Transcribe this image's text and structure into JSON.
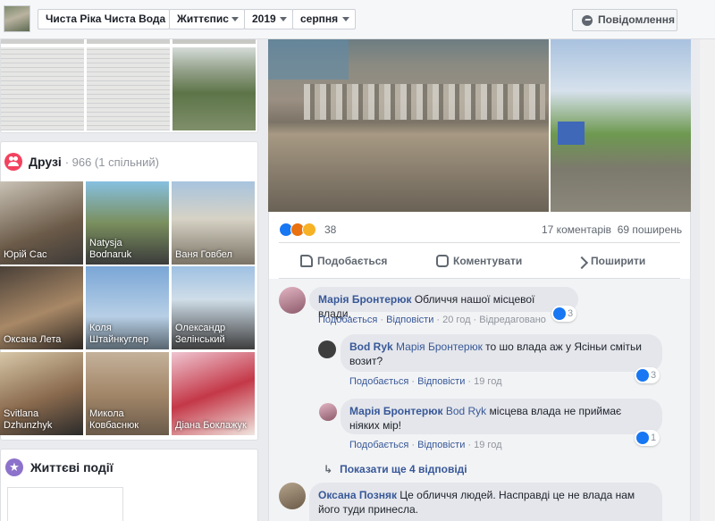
{
  "topbar": {
    "page_name": "Чиста Ріка Чиста Вода",
    "section": "Життєпис",
    "year": "2019",
    "month": "серпня",
    "message_button": "Повідомлення"
  },
  "friends": {
    "title": "Друзі",
    "count": "· 966 (1 спільний)",
    "items": [
      {
        "name": "Юрій Сас"
      },
      {
        "name": "Natysja Bodnaruk"
      },
      {
        "name": "Ваня Говбел"
      },
      {
        "name": "Оксана Лета"
      },
      {
        "name": "Коля Штайнкуглер"
      },
      {
        "name": "Олександр Зелінський"
      },
      {
        "name": "Svitlana Dzhunzhyk"
      },
      {
        "name": "Микола Ковбаснюк"
      },
      {
        "name": "Діана Боклажук"
      }
    ]
  },
  "life_events": {
    "title": "Життєві події"
  },
  "post": {
    "reaction_count": "38",
    "comments_count": "17 коментарів",
    "shares_count": "69 поширень",
    "actions": {
      "like": "Подобається",
      "comment": "Коментувати",
      "share": "Поширити"
    }
  },
  "comments": [
    {
      "author": "Марія Бронтерюк",
      "text": "Обличчя нашої місцевої влади.",
      "like_label": "Подобається",
      "reply_label": "Відповісти",
      "time": "20 год",
      "edited": "Відредаговано",
      "likes": "3"
    },
    {
      "author": "Bod Ryk",
      "mention": "Марія Бронтерюк",
      "text": "то шо влада аж у Ясіньи смітьи возит?",
      "like_label": "Подобається",
      "reply_label": "Відповісти",
      "time": "19 год",
      "likes": "3"
    },
    {
      "author": "Марія Бронтерюк",
      "mention": "Bod Ryk",
      "text": "місцева влада не приймає ніяких мір!",
      "like_label": "Подобається",
      "reply_label": "Відповісти",
      "time": "19 год",
      "likes": "1"
    },
    {
      "author": "Оксана Позняк",
      "text": "Це обличчя людей. Насправді це не влада нам його туди принесла."
    }
  ],
  "show_more_replies": "Показати ще 4 відповіді",
  "colors": {
    "link": "#385898",
    "accent": "#1877f2",
    "friends_icon": "#f3425f",
    "life_icon": "#8c72cb"
  }
}
